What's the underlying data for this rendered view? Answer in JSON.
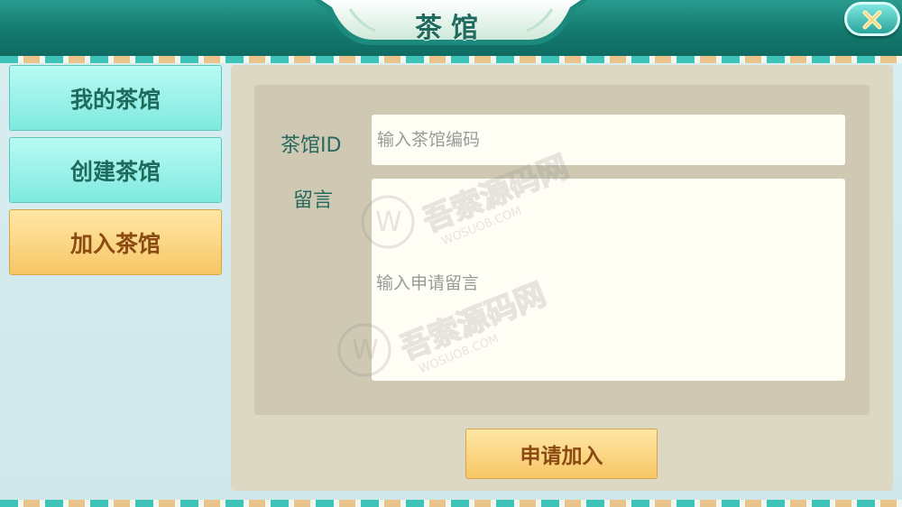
{
  "header": {
    "title": "茶馆",
    "close_icon": "close-icon"
  },
  "sidebar": {
    "items": [
      {
        "label": "我的茶馆",
        "active": false
      },
      {
        "label": "创建茶馆",
        "active": false
      },
      {
        "label": "加入茶馆",
        "active": true
      }
    ]
  },
  "form": {
    "id_label": "茶馆ID",
    "id_placeholder": "输入茶馆编码",
    "id_value": "",
    "message_label": "留言",
    "message_placeholder": "输入申请留言",
    "message_value": "",
    "submit_label": "申请加入"
  },
  "watermark": {
    "text": "吾索源码网",
    "url": "WOSUO8.COM"
  },
  "colors": {
    "header_teal": "#137a6f",
    "teal_button": "#7fe9df",
    "gold_button": "#f7c665",
    "label_text": "#266a5e",
    "button_text_brown": "#8a4a12"
  }
}
